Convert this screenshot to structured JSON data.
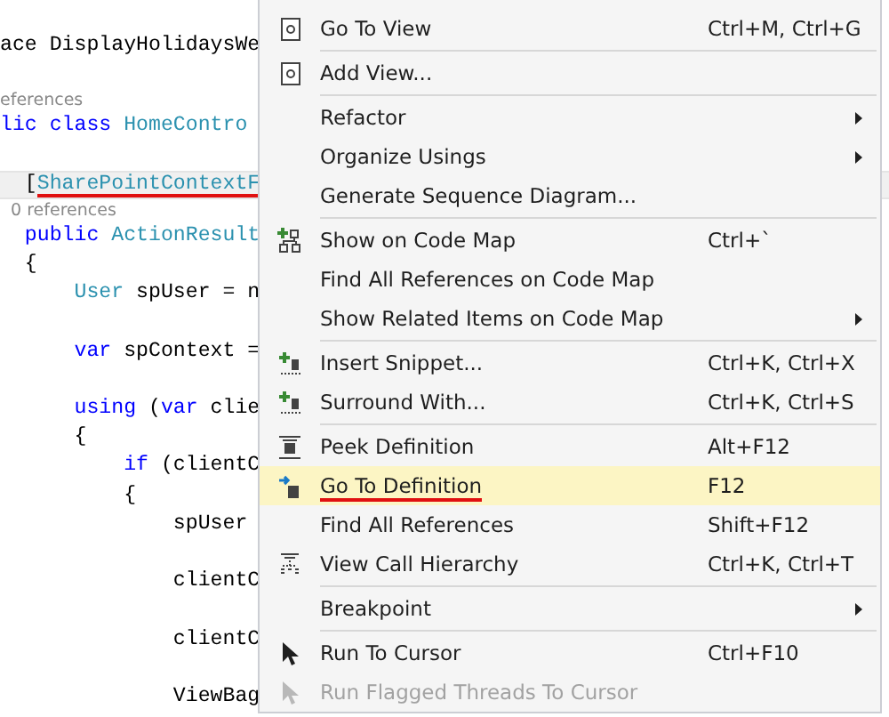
{
  "editor": {
    "lines": [
      {
        "kind": "code",
        "gap_after": true,
        "tokens": [
          {
            "kind": "plain",
            "text": "ace DisplayHolidaysWe"
          }
        ]
      },
      {
        "kind": "lens",
        "gap_after": false,
        "tokens": [
          {
            "kind": "plain",
            "text": "eferences"
          }
        ]
      },
      {
        "kind": "code",
        "gap_after": true,
        "tokens": [
          {
            "kind": "keyword",
            "text": "lic class "
          },
          {
            "kind": "type",
            "text": "HomeContro"
          }
        ]
      },
      {
        "kind": "code",
        "gap_after": false,
        "current": true,
        "tokens": [
          {
            "kind": "plain",
            "text": "  ["
          },
          {
            "kind": "type",
            "text": "SharePointContextF",
            "underlined": true
          }
        ]
      },
      {
        "kind": "lens",
        "gap_after": false,
        "tokens": [
          {
            "kind": "plain",
            "text": "  0 references"
          }
        ]
      },
      {
        "kind": "code",
        "gap_after": false,
        "tokens": [
          {
            "kind": "keyword",
            "text": "  public "
          },
          {
            "kind": "type",
            "text": "ActionResult"
          }
        ]
      },
      {
        "kind": "code",
        "gap_after": false,
        "tokens": [
          {
            "kind": "plain",
            "text": "  {"
          }
        ]
      },
      {
        "kind": "code",
        "gap_after": true,
        "tokens": [
          {
            "kind": "type",
            "text": "      User"
          },
          {
            "kind": "plain",
            "text": " spUser = n"
          }
        ]
      },
      {
        "kind": "code",
        "gap_after": true,
        "tokens": [
          {
            "kind": "keyword",
            "text": "      var"
          },
          {
            "kind": "plain",
            "text": " spContext ="
          }
        ]
      },
      {
        "kind": "code",
        "gap_after": false,
        "tokens": [
          {
            "kind": "keyword",
            "text": "      using"
          },
          {
            "kind": "plain",
            "text": " ("
          },
          {
            "kind": "keyword",
            "text": "var"
          },
          {
            "kind": "plain",
            "text": " clie"
          }
        ]
      },
      {
        "kind": "code",
        "gap_after": false,
        "tokens": [
          {
            "kind": "plain",
            "text": "      {"
          }
        ]
      },
      {
        "kind": "code",
        "gap_after": false,
        "tokens": [
          {
            "kind": "keyword",
            "text": "          if"
          },
          {
            "kind": "plain",
            "text": " (clientC"
          }
        ]
      },
      {
        "kind": "code",
        "gap_after": false,
        "tokens": [
          {
            "kind": "plain",
            "text": "          {"
          }
        ]
      },
      {
        "kind": "code",
        "gap_after": true,
        "tokens": [
          {
            "kind": "plain",
            "text": "              spUser"
          }
        ]
      },
      {
        "kind": "code",
        "gap_after": true,
        "tokens": [
          {
            "kind": "plain",
            "text": "              clientC"
          }
        ]
      },
      {
        "kind": "code",
        "gap_after": true,
        "tokens": [
          {
            "kind": "plain",
            "text": "              clientC"
          }
        ]
      },
      {
        "kind": "code",
        "gap_after": false,
        "tokens": [
          {
            "kind": "plain",
            "text": "              ViewBag"
          }
        ]
      }
    ]
  },
  "context_menu": {
    "groups": [
      [
        {
          "label": "Go To View",
          "shortcut": "Ctrl+M, Ctrl+G",
          "kind": "view",
          "submenu": false,
          "selected": false,
          "disabled": false,
          "underlined": false
        }
      ],
      [
        {
          "label": "Add View...",
          "kind": "view",
          "submenu": false,
          "selected": false,
          "disabled": false,
          "underlined": false
        }
      ],
      [
        {
          "label": "Refactor",
          "submenu": true,
          "selected": false,
          "disabled": false,
          "underlined": false
        },
        {
          "label": "Organize Usings",
          "submenu": true,
          "selected": false,
          "disabled": false,
          "underlined": false
        },
        {
          "label": "Generate Sequence Diagram...",
          "submenu": false,
          "selected": false,
          "disabled": false,
          "underlined": false
        }
      ],
      [
        {
          "label": "Show on Code Map",
          "shortcut": "Ctrl+`",
          "kind": "codemap",
          "submenu": false,
          "selected": false,
          "disabled": false,
          "underlined": false
        },
        {
          "label": "Find All References on Code Map",
          "submenu": false,
          "selected": false,
          "disabled": false,
          "underlined": false
        },
        {
          "label": "Show Related Items on Code Map",
          "submenu": true,
          "selected": false,
          "disabled": false,
          "underlined": false
        }
      ],
      [
        {
          "label": "Insert Snippet...",
          "shortcut": "Ctrl+K, Ctrl+X",
          "kind": "snippet",
          "submenu": false,
          "selected": false,
          "disabled": false,
          "underlined": false
        },
        {
          "label": "Surround With...",
          "shortcut": "Ctrl+K, Ctrl+S",
          "kind": "snippet",
          "submenu": false,
          "selected": false,
          "disabled": false,
          "underlined": false
        }
      ],
      [
        {
          "label": "Peek Definition",
          "shortcut": "Alt+F12",
          "kind": "peek",
          "submenu": false,
          "selected": false,
          "disabled": false,
          "underlined": false
        },
        {
          "label": "Go To Definition",
          "shortcut": "F12",
          "kind": "goto",
          "submenu": false,
          "selected": true,
          "disabled": false,
          "underlined": true
        },
        {
          "label": "Find All References",
          "shortcut": "Shift+F12",
          "submenu": false,
          "selected": false,
          "disabled": false,
          "underlined": false
        },
        {
          "label": "View Call Hierarchy",
          "shortcut": "Ctrl+K, Ctrl+T",
          "kind": "hierarchy",
          "submenu": false,
          "selected": false,
          "disabled": false,
          "underlined": false
        }
      ],
      [
        {
          "label": "Breakpoint",
          "submenu": true,
          "selected": false,
          "disabled": false,
          "underlined": false
        }
      ],
      [
        {
          "label": "Run To Cursor",
          "shortcut": "Ctrl+F10",
          "kind": "cursor",
          "submenu": false,
          "selected": false,
          "disabled": false,
          "underlined": false
        },
        {
          "label": "Run Flagged Threads To Cursor",
          "kind": "cursor",
          "submenu": false,
          "selected": false,
          "disabled": true,
          "underlined": false
        }
      ]
    ]
  }
}
